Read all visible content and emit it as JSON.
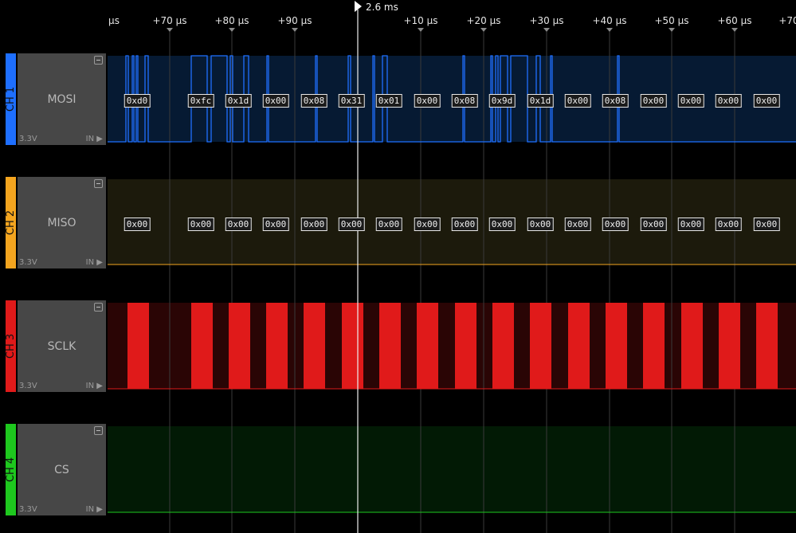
{
  "ruler": {
    "ticks": [
      {
        "label": "µs"
      },
      {
        "label": "+70 µs"
      },
      {
        "label": "+80 µs"
      },
      {
        "label": "+90 µs"
      },
      {
        "label": "+10 µs"
      },
      {
        "label": "+20 µs"
      },
      {
        "label": "+30 µs"
      },
      {
        "label": "+40 µs"
      },
      {
        "label": "+50 µs"
      },
      {
        "label": "+60 µs"
      },
      {
        "label": "+70"
      }
    ],
    "trigger_label": "2.6 ms"
  },
  "channels": [
    {
      "id": "CH 1",
      "name": "MOSI",
      "voltage": "3.3V",
      "mode": "IN",
      "color": "#1e6fff",
      "decoded": [
        "0xd0",
        "0xfc",
        "0x1d",
        "0x00",
        "0x08",
        "0x31",
        "0x01",
        "0x00",
        "0x08",
        "0x9d",
        "0x1d",
        "0x00",
        "0x08",
        "0x00",
        "0x00",
        "0x00",
        "0x00"
      ]
    },
    {
      "id": "CH 2",
      "name": "MISO",
      "voltage": "3.3V",
      "mode": "IN",
      "color": "#f4a51f",
      "decoded": [
        "0x00",
        "0x00",
        "0x00",
        "0x00",
        "0x00",
        "0x00",
        "0x00",
        "0x00",
        "0x00",
        "0x00",
        "0x00",
        "0x00",
        "0x00",
        "0x00",
        "0x00",
        "0x00",
        "0x00"
      ]
    },
    {
      "id": "CH 3",
      "name": "SCLK",
      "voltage": "3.3V",
      "mode": "IN",
      "color": "#e01a1a",
      "decoded": []
    },
    {
      "id": "CH 4",
      "name": "CS",
      "voltage": "3.3V",
      "mode": "IN",
      "color": "#1ec81e",
      "decoded": []
    }
  ]
}
